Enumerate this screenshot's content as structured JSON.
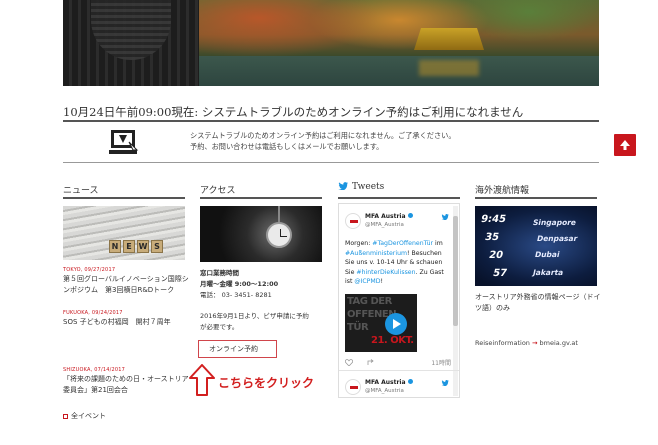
{
  "notice": {
    "title": "10月24日午前09:00現在: システムトラブルのためオンライン予約はご利用になれません",
    "line1": "システムトラブルのためオンライン予約はご利用になれません。ご了承ください。",
    "line2": "予約、お問い合わせは電話もしくはメールでお願いします。"
  },
  "news": {
    "heading": "ニュース",
    "image_tiles": [
      "N",
      "E",
      "W",
      "S"
    ],
    "items": [
      {
        "meta": "TOKYO, 09/27/2017",
        "title": "第５回グローバルイノベーション国際シンポジウム　第3回横日R&Dトーク"
      },
      {
        "meta": "FUKUOKA, 09/24/2017",
        "title": "SOS 子どもの村福岡　開村７周年"
      },
      {
        "meta": "SHIZUOKA, 07/14/2017",
        "title": "「将来の課題のための日・オーストリア委員会」第21回会合"
      }
    ],
    "all_events": "全イベント"
  },
  "access": {
    "heading": "アクセス",
    "hours_title": "窓口業務時間",
    "hours": "月曜～金曜 9:00～12:00",
    "phone": "電話： 03- 3451- 8281",
    "note_line1": "2016年9月1日より、ビザ申請に予約",
    "note_line2": "が必要です。",
    "reserve_button": "オンライン予約",
    "annotation": "こちらをクリック"
  },
  "tweets": {
    "heading": "Tweets",
    "tweet1": {
      "name": "MFA Austria",
      "handle": "@MFA_Austria",
      "body_parts": [
        {
          "t": "Morgen: ",
          "link": false
        },
        {
          "t": "#TagDerOffenenTür",
          "link": true
        },
        {
          "t": " im ",
          "link": false
        },
        {
          "t": "#Außenministerium",
          "link": true
        },
        {
          "t": "! Besuchen Sie uns v. 10-14 Uhr & schauen Sie ",
          "link": false
        },
        {
          "t": "#hinterDieKulissen",
          "link": true
        },
        {
          "t": ". Zu Gast ist ",
          "link": false
        },
        {
          "t": "@ICPMD",
          "link": true
        },
        {
          "t": "!",
          "link": false
        }
      ],
      "video_text": [
        "TAG DER",
        "OFFENEN",
        "TÜR",
        "21. OKT."
      ],
      "time": "11時間"
    },
    "tweet2": {
      "name": "MFA Austria",
      "handle": "@MFA_Austria"
    }
  },
  "overseas": {
    "heading": "海外渡航情報",
    "board_rows": [
      "Singapore",
      "Denpasar",
      "Dubai",
      "Jakarta"
    ],
    "board_numbers": [
      "9:45",
      "35",
      "20",
      "57"
    ],
    "description": "オーストリア外務省の情報ページ（ドイツ語）のみ",
    "link_label": "Reiseinformation",
    "link_target": "bmeia.gv.at"
  },
  "colors": {
    "accent": "#c8161d",
    "twitter": "#1b95e0"
  }
}
